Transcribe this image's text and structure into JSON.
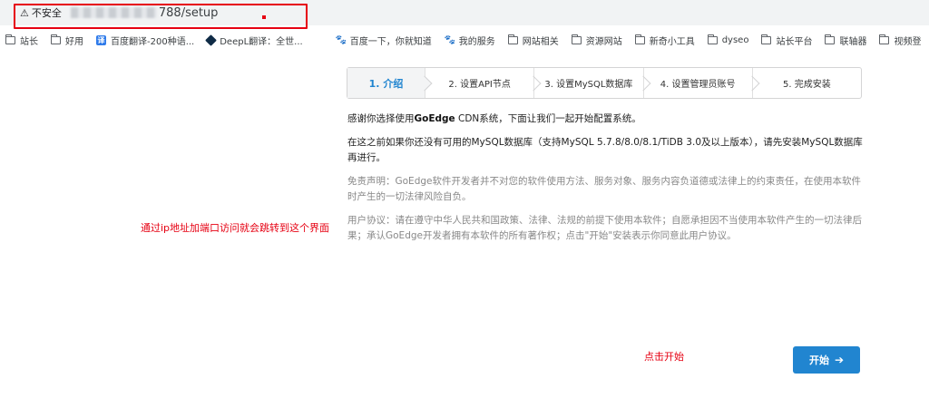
{
  "browser": {
    "security_icon": "warning-triangle-icon",
    "security_label": "不安全",
    "url_visible": "788/setup"
  },
  "bookmarks": [
    {
      "label": "站长",
      "icon": "folder-icon"
    },
    {
      "label": "好用",
      "icon": "folder-icon"
    },
    {
      "label": "百度翻译-200种语...",
      "icon": "baidu-translate-icon"
    },
    {
      "label": "DeepL翻译：全世...",
      "icon": "deepl-icon"
    },
    {
      "label": "百度一下，你就知道",
      "icon": "baidu-icon"
    },
    {
      "label": "我的服务",
      "icon": "paw-icon"
    },
    {
      "label": "网站相关",
      "icon": "folder-icon"
    },
    {
      "label": "资源网站",
      "icon": "folder-icon"
    },
    {
      "label": "新奇小工具",
      "icon": "folder-icon"
    },
    {
      "label": "dyseo",
      "icon": "folder-icon"
    },
    {
      "label": "站长平台",
      "icon": "folder-icon"
    },
    {
      "label": "联轴器",
      "icon": "folder-icon"
    },
    {
      "label": "视频登",
      "icon": "folder-icon"
    }
  ],
  "steps": [
    {
      "label": "1. 介绍",
      "active": true
    },
    {
      "label": "2. 设置API节点",
      "active": false
    },
    {
      "label": "3. 设置MySQL数据库",
      "active": false
    },
    {
      "label": "4. 设置管理员账号",
      "active": false
    },
    {
      "label": "5. 完成安装",
      "active": false
    }
  ],
  "content": {
    "intro_before": "感谢你选择使用",
    "intro_brand": "GoEdge",
    "intro_after": " CDN系统，下面让我们一起开始配置系统。",
    "mysql_note": "在这之前如果你还没有可用的MySQL数据库（支持MySQL 5.7.8/8.0/8.1/TiDB 3.0及以上版本），请先安装MySQL数据库再进行。",
    "disclaimer": "免责声明：GoEdge软件开发者并不对您的软件使用方法、服务对象、服务内容负道德或法律上的约束责任，在使用本软件时产生的一切法律风险自负。",
    "agreement": "用户协议：请在遵守中华人民共和国政策、法律、法规的前提下使用本软件；自愿承担因不当使用本软件产生的一切法律后果；承认GoEdge开发者拥有本软件的所有著作权；点击\"开始\"安装表示你同意此用户协议。"
  },
  "annotations": {
    "left_note": "通过ip地址加端口访问就会跳转到这个界面",
    "click_note": "点击开始"
  },
  "start_button": {
    "label": "开始",
    "icon": "arrow-right-icon"
  },
  "colors": {
    "primary": "#2185d0",
    "annotation_red": "#e60012"
  }
}
